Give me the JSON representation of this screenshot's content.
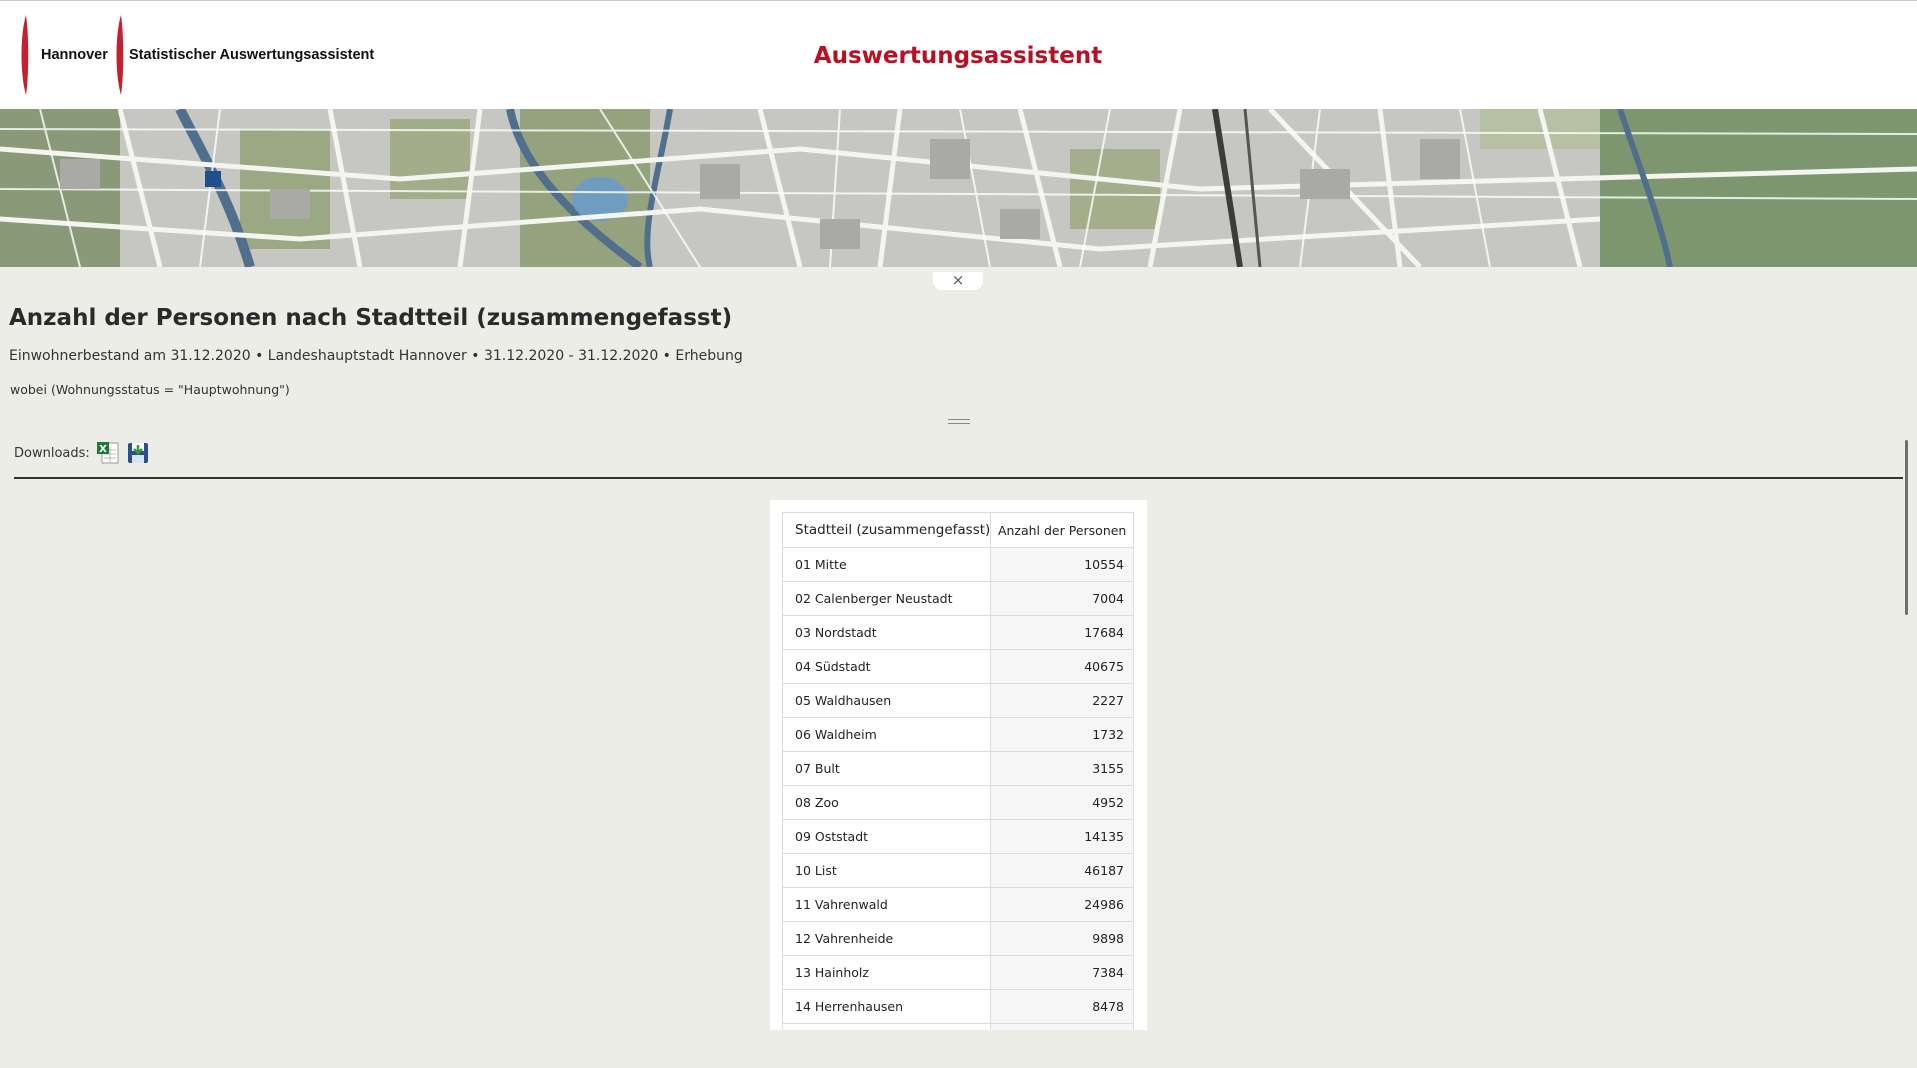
{
  "header": {
    "logo_city": "Hannover",
    "logo_app": "Statistischer Auswertungsassistent",
    "app_title": "Auswertungsassistent",
    "brand_color": "#b90f22"
  },
  "banner": {
    "collapse_label": "×"
  },
  "report": {
    "title": "Anzahl der Personen nach Stadtteil (zusammengefasst)",
    "subtitle": "Einwohnerbestand am 31.12.2020 • Landeshauptstadt Hannover • 31.12.2020 - 31.12.2020 • Erhebung",
    "filter": "wobei (Wohnungsstatus = \"Hauptwohnung\")"
  },
  "downloads": {
    "label": "Downloads:",
    "icons": [
      "excel-icon",
      "save-icon"
    ]
  },
  "table": {
    "columns": [
      "Stadtteil (zusammengefasst)",
      "Anzahl der Personen"
    ],
    "rows": [
      [
        "01 Mitte",
        "10554"
      ],
      [
        "02 Calenberger Neustadt",
        "7004"
      ],
      [
        "03 Nordstadt",
        "17684"
      ],
      [
        "04 Südstadt",
        "40675"
      ],
      [
        "05 Waldhausen",
        "2227"
      ],
      [
        "06 Waldheim",
        "1732"
      ],
      [
        "07 Bult",
        "3155"
      ],
      [
        "08 Zoo",
        "4952"
      ],
      [
        "09 Oststadt",
        "14135"
      ],
      [
        "10 List",
        "46187"
      ],
      [
        "11 Vahrenwald",
        "24986"
      ],
      [
        "12 Vahrenheide",
        "9898"
      ],
      [
        "13 Hainholz",
        "7384"
      ],
      [
        "14 Herrenhausen",
        "8478"
      ]
    ]
  }
}
